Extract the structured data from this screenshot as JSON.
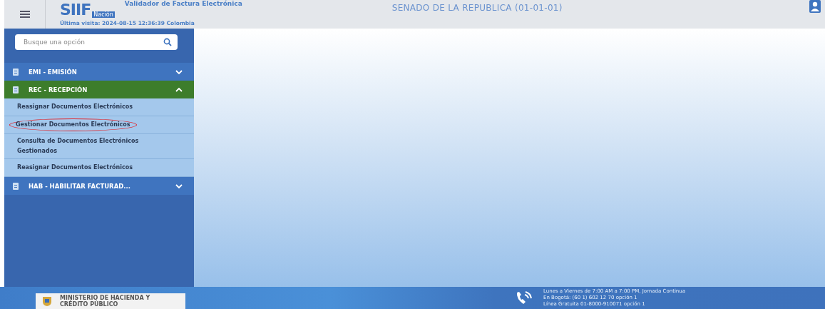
{
  "header": {
    "logo": "SIIF",
    "logo_sub": "Nación",
    "app_title": "Validador de Factura Electrónica",
    "last_visit": "Última visita: 2024-08-15 12:36:39 Colombia",
    "entity": "SENADO DE LA REPUBLICA (01-01-01)"
  },
  "sidebar": {
    "search": {
      "placeholder": "Busque una opción"
    },
    "menu": [
      {
        "label": "EMI - EMISIÓN",
        "expanded": false,
        "selected": false
      },
      {
        "label": "REC - RECEPCIÓN",
        "expanded": true,
        "selected": true,
        "children": [
          {
            "label": "Reasignar Documentos Electrónicos",
            "circled": false
          },
          {
            "label": "Gestionar Documentos Electrónicos",
            "circled": true
          },
          {
            "label": "Consulta de Documentos Electrónicos Gestionados",
            "circled": false
          },
          {
            "label": "Reasignar Documentos Electrónicos",
            "circled": false
          }
        ]
      },
      {
        "label": "HAB - HABILITAR FACTURAD...",
        "expanded": false,
        "selected": false
      }
    ]
  },
  "footer": {
    "ministry": "MINISTERIO DE HACIENDA Y CRÉDITO PÚBLICO",
    "contact_lines": [
      "Lunes a Viernes de 7:00 AM a 7:00 PM, Jornada Continua",
      "En Bogotá: (60 1) 602 12 70 opción 1",
      "Línea Gratuita 01-8000-910071 opción 1"
    ]
  }
}
